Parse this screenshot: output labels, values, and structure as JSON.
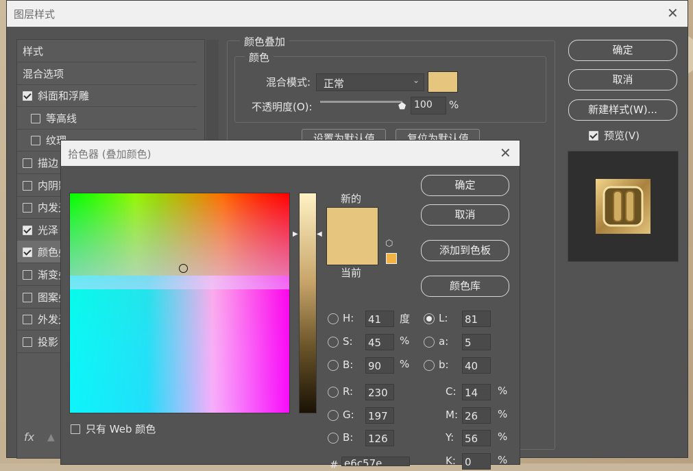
{
  "layer_style": {
    "title": "图层样式",
    "left_items": [
      {
        "label": "样式",
        "checkbox": false,
        "checked": false,
        "indent": false
      },
      {
        "label": "混合选项",
        "checkbox": false,
        "checked": false,
        "indent": false
      },
      {
        "label": "斜面和浮雕",
        "checkbox": true,
        "checked": true,
        "indent": false
      },
      {
        "label": "等高线",
        "checkbox": true,
        "checked": false,
        "indent": true
      },
      {
        "label": "纹理",
        "checkbox": true,
        "checked": false,
        "indent": true
      },
      {
        "label": "描边",
        "checkbox": true,
        "checked": false,
        "indent": false
      },
      {
        "label": "内阴影",
        "checkbox": true,
        "checked": false,
        "indent": false
      },
      {
        "label": "内发光",
        "checkbox": true,
        "checked": false,
        "indent": false
      },
      {
        "label": "光泽",
        "checkbox": true,
        "checked": true,
        "indent": false
      },
      {
        "label": "颜色叠加",
        "checkbox": true,
        "checked": true,
        "indent": false,
        "selected": true
      },
      {
        "label": "渐变叠加",
        "checkbox": true,
        "checked": false,
        "indent": false
      },
      {
        "label": "图案叠加",
        "checkbox": true,
        "checked": false,
        "indent": false
      },
      {
        "label": "外发光",
        "checkbox": true,
        "checked": false,
        "indent": false
      },
      {
        "label": "投影",
        "checkbox": true,
        "checked": false,
        "indent": false
      }
    ],
    "fx_label": "fx",
    "color_overlay_group": "颜色叠加",
    "color_group": "颜色",
    "blend_mode_label": "混合模式:",
    "blend_mode_value": "正常",
    "opacity_label": "不透明度(O):",
    "opacity_value": "100",
    "opacity_unit": "%",
    "set_default": "设置为默认值",
    "reset_default": "复位为默认值",
    "buttons": {
      "ok": "确定",
      "cancel": "取消",
      "new_style": "新建样式(W)..."
    },
    "preview_label": "预览(V)",
    "preview_checked": true,
    "overlay_color": "#e6c57e"
  },
  "color_picker": {
    "title": "拾色器 (叠加颜色)",
    "new_label": "新的",
    "current_label": "当前",
    "buttons": {
      "ok": "确定",
      "cancel": "取消",
      "add_swatch": "添加到色板",
      "color_library": "颜色库"
    },
    "web_only_label": "只有 Web 颜色",
    "hsb": [
      {
        "label": "H:",
        "value": "41",
        "unit": "度",
        "selected": false
      },
      {
        "label": "S:",
        "value": "45",
        "unit": "%",
        "selected": false
      },
      {
        "label": "B:",
        "value": "90",
        "unit": "%",
        "selected": false
      }
    ],
    "lab": [
      {
        "label": "L:",
        "value": "81",
        "selected": true
      },
      {
        "label": "a:",
        "value": "5",
        "selected": false
      },
      {
        "label": "b:",
        "value": "40",
        "selected": false
      }
    ],
    "rgb": [
      {
        "label": "R:",
        "value": "230"
      },
      {
        "label": "G:",
        "value": "197"
      },
      {
        "label": "B:",
        "value": "126"
      }
    ],
    "cmyk": [
      {
        "label": "C:",
        "value": "14",
        "unit": "%"
      },
      {
        "label": "M:",
        "value": "26",
        "unit": "%"
      },
      {
        "label": "Y:",
        "value": "56",
        "unit": "%"
      },
      {
        "label": "K:",
        "value": "0",
        "unit": "%"
      }
    ],
    "hex_label": "#",
    "hex_value": "e6c57e",
    "new_color": "#e6c57e",
    "current_color": "#e6c57e",
    "gamut_swatch": "#f3b344"
  }
}
